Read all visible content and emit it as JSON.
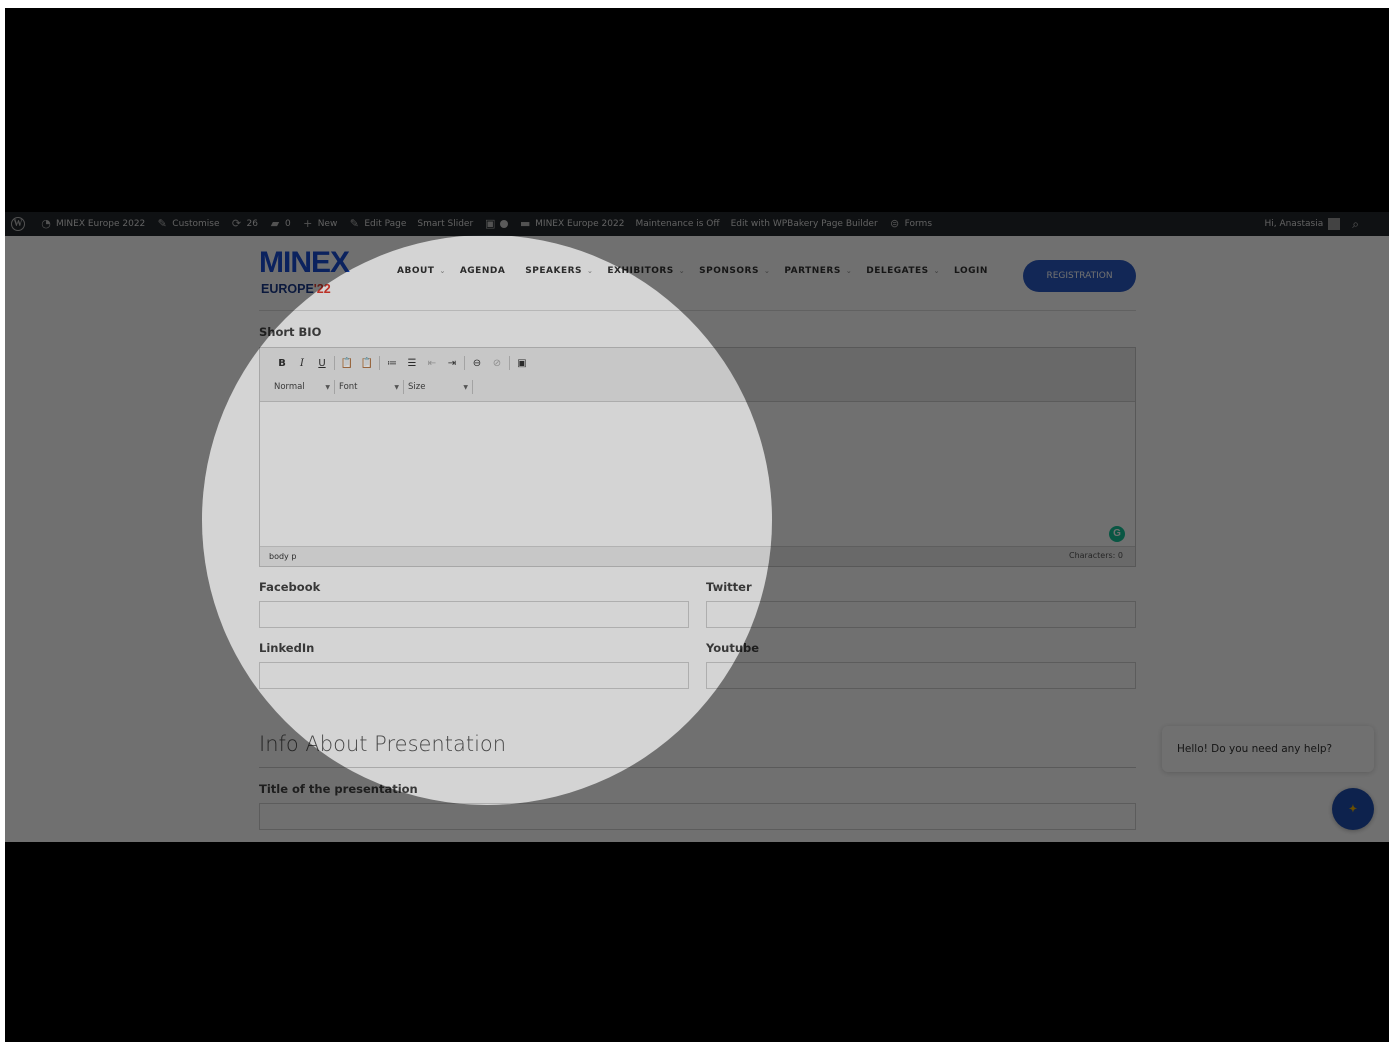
{
  "admin_bar": {
    "site_name": "MINEX Europe 2022",
    "customise": "Customise",
    "updates_count": "26",
    "comments_count": "0",
    "new": "New",
    "edit_page": "Edit Page",
    "smart_slider": "Smart Slider",
    "site_name_2": "MINEX Europe 2022",
    "maintenance": "Maintenance is Off",
    "wpbakery": "Edit with WPBakery Page Builder",
    "forms": "Forms",
    "greeting": "Hi, Anastasia"
  },
  "logo": {
    "top": "MINEX",
    "bottom_text": "EUROPE",
    "bottom_year": "'22"
  },
  "nav": {
    "items": [
      {
        "label": "ABOUT",
        "has_caret": true
      },
      {
        "label": "AGENDA",
        "has_caret": false
      },
      {
        "label": "SPEAKERS",
        "has_caret": true
      },
      {
        "label": "EXHIBITORS",
        "has_caret": true
      },
      {
        "label": "SPONSORS",
        "has_caret": true
      },
      {
        "label": "PARTNERS",
        "has_caret": true
      },
      {
        "label": "DELEGATES",
        "has_caret": true
      },
      {
        "label": "LOGIN",
        "has_caret": false
      }
    ],
    "registration": "REGISTRATION"
  },
  "form": {
    "short_bio_label": "Short BIO",
    "toolbar": {
      "bold": "B",
      "italic": "I",
      "underline": "U",
      "format": "Normal",
      "font": "Font",
      "size": "Size"
    },
    "status_path": "body  p",
    "characters": "Characters: 0",
    "facebook_label": "Facebook",
    "twitter_label": "Twitter",
    "linkedin_label": "LinkedIn",
    "youtube_label": "Youtube",
    "section_title": "Info About Presentation",
    "presentation_title_label": "Title of the presentation"
  },
  "chat": {
    "message": "Hello! Do you need any help?"
  },
  "colors": {
    "accent": "#2b59c3",
    "admin_bar": "#23282d",
    "grammarly": "#15c39a"
  }
}
